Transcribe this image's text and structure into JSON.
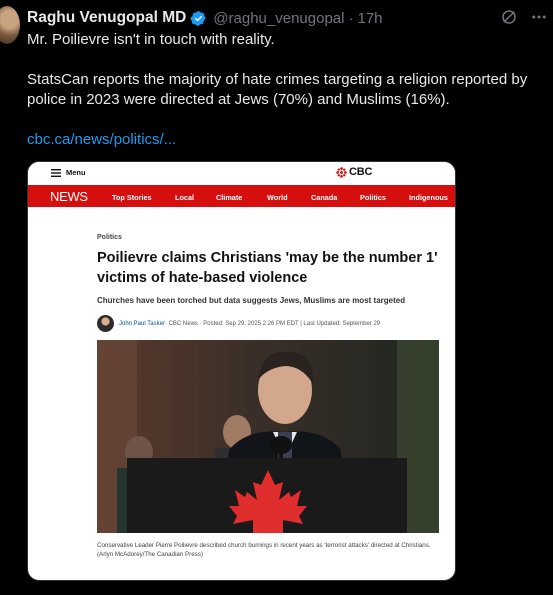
{
  "tweet": {
    "author_name": "Raghu Venugopal MD",
    "handle": "@raghu_venugopal",
    "separator": "·",
    "time": "17h",
    "text_line1": "Mr. Poilievre isn't in touch with reality.",
    "text_line2": "StatsCan reports the majority of hate crimes targeting a religion reported by police in 2023 were directed at Jews (70%) and Muslims (16%).",
    "link_text": "cbc.ca/news/politics/...",
    "icons": {
      "verified": "verified-badge-icon",
      "grok": "grok-icon",
      "more": "more-icon"
    },
    "colors": {
      "background": "#000000",
      "text": "#e7e9ea",
      "muted": "#71767b",
      "link": "#1d9bf0"
    }
  },
  "card": {
    "menu_label": "Menu",
    "logo_text": "CBC",
    "nav": {
      "news": "NEWS",
      "items": [
        "Top Stories",
        "Local",
        "Climate",
        "World",
        "Canada",
        "Politics",
        "Indigenous"
      ]
    },
    "section": "Politics",
    "headline": "Poilievre claims Christians 'may be the number 1' victims of hate-based violence",
    "deck": "Churches have been torched but data suggests Jews, Muslims are most targeted",
    "byline": {
      "author": "John Paul Tasker",
      "rest": " · CBC News · Posted: Sep 29, 2025 2:26 PM EDT | Last Updated: September 29"
    },
    "caption": "Conservative Leader Pierre Poilievre described church burnings in recent years as 'terrorist attacks' directed at Christians. (Arlyn McAdorey/The Canadian Press)",
    "colors": {
      "cbc_red": "#d50e0e",
      "card_bg": "#ffffff"
    }
  }
}
